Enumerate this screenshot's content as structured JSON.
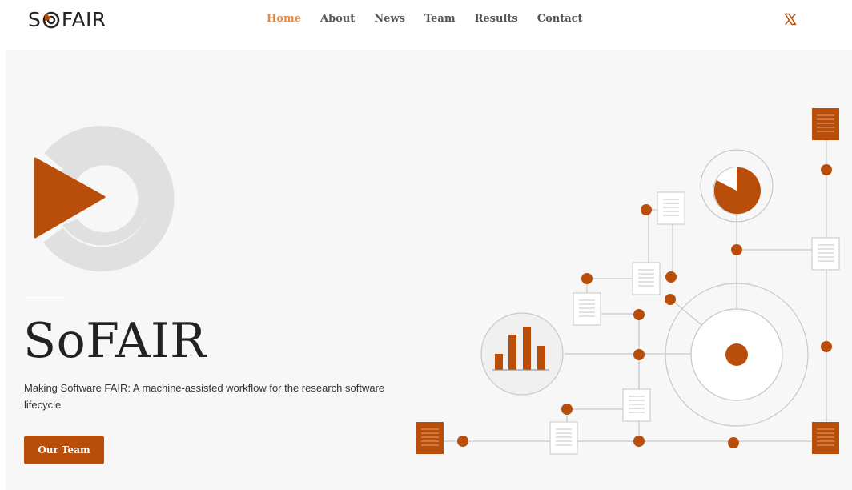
{
  "header": {
    "logo": {
      "prefix": "S",
      "suffix": "FAIR"
    },
    "nav": [
      "Home",
      "About",
      "News",
      "Team",
      "Results",
      "Contact"
    ],
    "active_nav": "Home",
    "social_icon": "x-icon"
  },
  "hero": {
    "title": "SoFAIR",
    "subtitle": "Making Software FAIR: A machine-assisted workflow for the research software lifecycle",
    "button_label": "Our Team"
  },
  "colors": {
    "accent": "#b94e0b",
    "nav_active": "#e08a4c",
    "hero_bg": "#f7f7f7",
    "ring_gray": "#e0e0e0"
  },
  "icons": [
    "play-icon",
    "ring-icon",
    "document-icon",
    "bar-chart-icon",
    "pie-chart-icon",
    "network-illustration"
  ]
}
